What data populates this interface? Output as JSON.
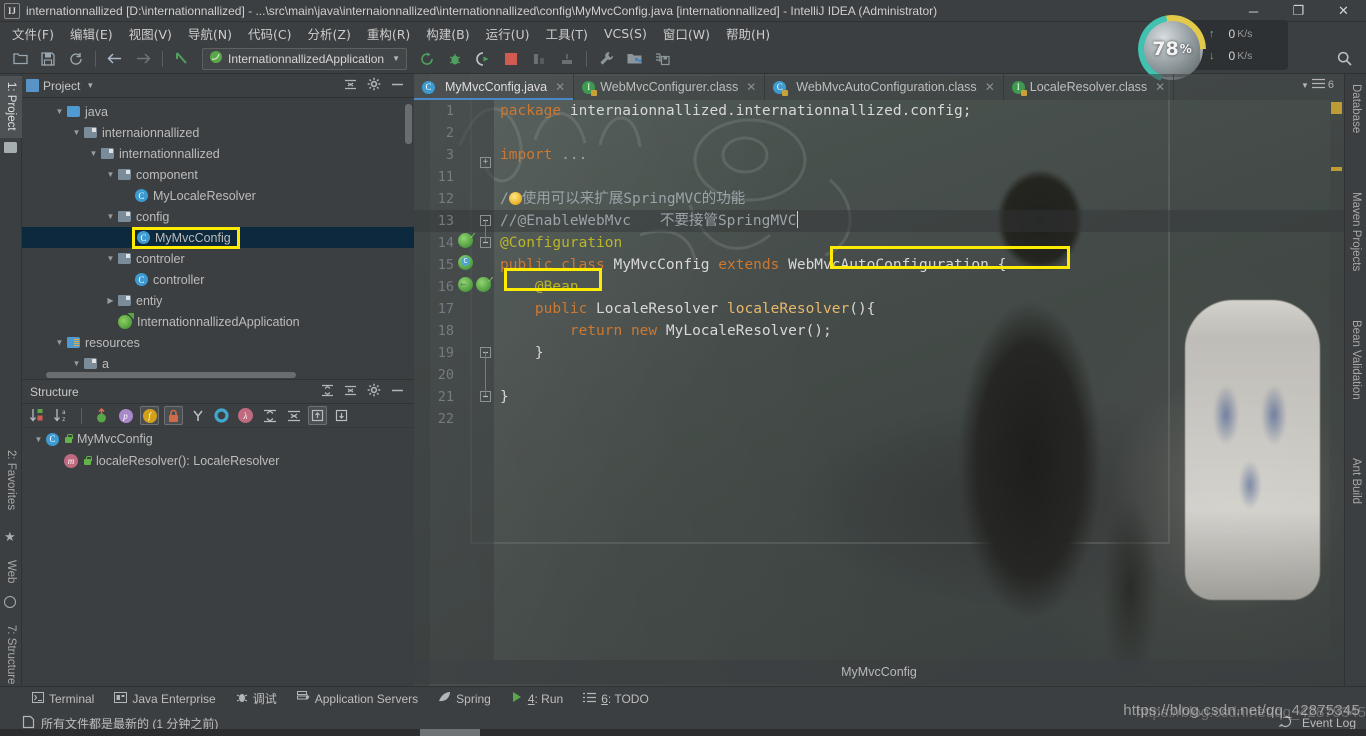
{
  "window": {
    "title": "internationnallized [D:\\internationnallized] - ...\\src\\main\\java\\internaionnallized\\internationnallized\\config\\MyMvcConfig.java [internationnallized] - IntelliJ IDEA (Administrator)",
    "app_icon": "intellij-idea-icon",
    "minimize": "─",
    "maximize": "❐",
    "close": "✕"
  },
  "menubar": {
    "items": [
      {
        "label": "文件(F)",
        "name": "menu-file"
      },
      {
        "label": "编辑(E)",
        "name": "menu-edit"
      },
      {
        "label": "视图(V)",
        "name": "menu-view"
      },
      {
        "label": "导航(N)",
        "name": "menu-navigate"
      },
      {
        "label": "代码(C)",
        "name": "menu-code"
      },
      {
        "label": "分析(Z)",
        "name": "menu-analyze"
      },
      {
        "label": "重构(R)",
        "name": "menu-refactor"
      },
      {
        "label": "构建(B)",
        "name": "menu-build"
      },
      {
        "label": "运行(U)",
        "name": "menu-run"
      },
      {
        "label": "工具(T)",
        "name": "menu-tools"
      },
      {
        "label": "VCS(S)",
        "name": "menu-vcs"
      },
      {
        "label": "窗口(W)",
        "name": "menu-window"
      },
      {
        "label": "帮助(H)",
        "name": "menu-help"
      }
    ]
  },
  "toolbar": {
    "run_config": "InternationnallizedApplication",
    "run_config_caret": "▼",
    "icons_left": [
      "open-folder-icon",
      "save-all-icon",
      "sync-icon",
      "back-arrow-icon",
      "forward-arrow-icon",
      "undo-arrow-icon"
    ],
    "icons_run": [
      "rerun-icon",
      "debug-icon",
      "run-with-coverage-icon",
      "stop-icon",
      "profile-icon",
      "attach-icon"
    ],
    "icons_right": [
      "settings-wrench-icon",
      "project-structure-icon",
      "save-structure-icon"
    ],
    "search_icon": "search-icon"
  },
  "net_widget": {
    "cpu_percent": "78",
    "cpu_percent_suffix": "%",
    "upload": "0",
    "upload_unit": "K/s",
    "download": "0",
    "download_unit": "K/s",
    "up_arrow": "↑",
    "down_arrow": "↓"
  },
  "left_strip": {
    "tabs": [
      {
        "label": "1: Project",
        "name": "sidebar-tab-project",
        "selected": true
      },
      {
        "label": "2: Favorites",
        "name": "sidebar-tab-favorites",
        "selected": false
      },
      {
        "label": "Web",
        "name": "sidebar-tab-web",
        "selected": false
      },
      {
        "label": "7: Structure",
        "name": "sidebar-tab-structure",
        "selected": false
      }
    ]
  },
  "right_strip": {
    "tabs": [
      {
        "label": "Database",
        "name": "sidebar-tab-database"
      },
      {
        "label": "Maven Projects",
        "name": "sidebar-tab-maven-projects"
      },
      {
        "label": "Bean Validation",
        "name": "sidebar-tab-bean-validation"
      },
      {
        "label": "Ant Build",
        "name": "sidebar-tab-ant-build"
      }
    ]
  },
  "project_panel": {
    "title": "Project",
    "title_caret": "▼",
    "actions": [
      "collapse-all-icon",
      "gear-icon",
      "hide-icon"
    ],
    "tree": [
      {
        "label": "java",
        "indent": 3,
        "type": "folder-source",
        "twisty": "▼"
      },
      {
        "label": "internaionnallized",
        "indent": 4,
        "type": "folder-package",
        "twisty": "▼"
      },
      {
        "label": "internationnallized",
        "indent": 5,
        "type": "folder-package",
        "twisty": "▼"
      },
      {
        "label": "component",
        "indent": 6,
        "type": "folder-package",
        "twisty": "▼"
      },
      {
        "label": "MyLocaleResolver",
        "indent": 7,
        "type": "class",
        "twisty": ""
      },
      {
        "label": "config",
        "indent": 6,
        "type": "folder-package",
        "twisty": "▼"
      },
      {
        "label": "MyMvcConfig",
        "indent": 7,
        "type": "class",
        "twisty": "",
        "selected": true,
        "highlighted": true
      },
      {
        "label": "controler",
        "indent": 6,
        "type": "folder-package",
        "twisty": "▼"
      },
      {
        "label": "controller",
        "indent": 7,
        "type": "class",
        "twisty": ""
      },
      {
        "label": "entiy",
        "indent": 6,
        "type": "folder-package",
        "twisty": "▶"
      },
      {
        "label": "InternationnallizedApplication",
        "indent": 6,
        "type": "spring-class",
        "twisty": ""
      },
      {
        "label": "resources",
        "indent": 3,
        "type": "folder-resources",
        "twisty": "▼"
      },
      {
        "label": "a",
        "indent": 4,
        "type": "folder-package",
        "twisty": "▼"
      }
    ]
  },
  "structure_panel": {
    "title": "Structure",
    "actions": [
      "expand-all-icon",
      "collapse-all-icon",
      "gear-icon",
      "hide-icon"
    ],
    "toolbar_icons": [
      "sort-by-visibility-icon",
      "sort-alphabetically-icon",
      "show-inherited-icon",
      "show-properties-icon",
      "show-fields-icon",
      "show-non-public-icon",
      "show-anonymous-icon",
      "show-interfaces-icon",
      "show-lambdas-icon",
      "expand-all-icon",
      "collapse-all-icon",
      "autoscroll-to-source-icon",
      "autoscroll-from-source-icon"
    ],
    "rows": [
      {
        "label": "MyMvcConfig",
        "indent": 1,
        "type": "class",
        "twisty": "▼"
      },
      {
        "label": "localeResolver(): LocaleResolver",
        "indent": 2,
        "type": "method",
        "twisty": ""
      }
    ]
  },
  "editor_tabs": {
    "tabs": [
      {
        "label": "MyMvcConfig.java",
        "icon": "java-class-icon",
        "active": true,
        "close": "✕"
      },
      {
        "label": "WebMvcConfigurer.class",
        "icon": "interface-locked-icon",
        "active": false,
        "close": "✕"
      },
      {
        "label": "WebMvcAutoConfiguration.class",
        "icon": "class-locked-icon",
        "active": false,
        "close": "✕"
      },
      {
        "label": "LocaleResolver.class",
        "icon": "interface-locked-icon",
        "active": false,
        "close": "✕"
      }
    ],
    "overflow_count": "6",
    "overflow_caret": "▼"
  },
  "editor": {
    "breadcrumb": "MyMvcConfig",
    "lines": [
      {
        "num": "1",
        "html": "<span class='kw'>package</span> <span class='ident'>internaionnallized.internationnallized.config</span><span class='punct'>;</span>"
      },
      {
        "num": "2",
        "html": ""
      },
      {
        "num": "3",
        "html": "<span class='kw'>import</span> <span class='cmt'>...</span>"
      },
      {
        "num": "11",
        "html": ""
      },
      {
        "num": "12",
        "html": "<span class='cmt'>/</span><span class='bulbslot'></span><span class='cmt'>使用可以来扩展SpringMVC的功能</span>"
      },
      {
        "num": "13",
        "html": "<span class='cmt'>//@EnableWebMvc　　不要接管SpringMVC</span><span class='caretslot'></span>"
      },
      {
        "num": "14",
        "html": "<span class='ann'>@Configuration</span>"
      },
      {
        "num": "15",
        "html": "<span class='kw'>public class</span> <span class='ident'>MyMvcConfig</span> <span class='kw'>extends</span> <span class='ident hl-extends'>WebMvcAutoConfiguration</span> <span class='punct'>{</span>"
      },
      {
        "num": "16",
        "html": "    <span class='ann hl-bean'>@Bean</span>"
      },
      {
        "num": "17",
        "html": "    <span class='kw'>public</span> <span class='ident'>LocaleResolver</span> <span class='fn'>localeResolver</span><span class='punct'>(){</span>"
      },
      {
        "num": "18",
        "html": "        <span class='kw'>return new</span> <span class='ident'>MyLocaleResolver</span><span class='punct'>();</span>"
      },
      {
        "num": "19",
        "html": "    <span class='punct'>}</span>"
      },
      {
        "num": "20",
        "html": ""
      },
      {
        "num": "21",
        "html": "<span class='punct'>}</span>"
      },
      {
        "num": "22",
        "html": ""
      }
    ],
    "annotations": {
      "extends_highlight_color": "#ffeb00",
      "bean_highlight_color": "#ffeb00"
    }
  },
  "toolwindow_bar": {
    "items": [
      {
        "label": "Terminal",
        "icon": "terminal-icon",
        "name": "toolwindow-terminal"
      },
      {
        "label": "Java Enterprise",
        "icon": "java-enterprise-icon",
        "name": "toolwindow-java-enterprise"
      },
      {
        "label": "调试",
        "icon": "debug-icon",
        "name": "toolwindow-debug"
      },
      {
        "label": "Application Servers",
        "icon": "app-servers-icon",
        "name": "toolwindow-application-servers"
      },
      {
        "label": "Spring",
        "icon": "spring-leaf-icon",
        "name": "toolwindow-spring"
      },
      {
        "label": "4: Run",
        "icon": "run-icon",
        "name": "toolwindow-run"
      },
      {
        "label": "6: TODO",
        "icon": "todo-icon",
        "name": "toolwindow-todo"
      }
    ]
  },
  "statusbar": {
    "message": "所有文件都是最新的 (1 分钟之前)",
    "message_icon": "file-sync-icon",
    "event_log": "Event Log",
    "event_log_icon": "event-log-icon"
  },
  "watermark": {
    "text": "https://blog.csdn.net/qq_42875345"
  },
  "colors": {
    "accent_blue": "#4a88c7",
    "highlight_yellow": "#ffeb00",
    "selection_blue": "#0d293e",
    "panel_bg": "#3c3f41",
    "keyword_orange": "#cc7832",
    "annotation_yellow": "#bbb529"
  }
}
